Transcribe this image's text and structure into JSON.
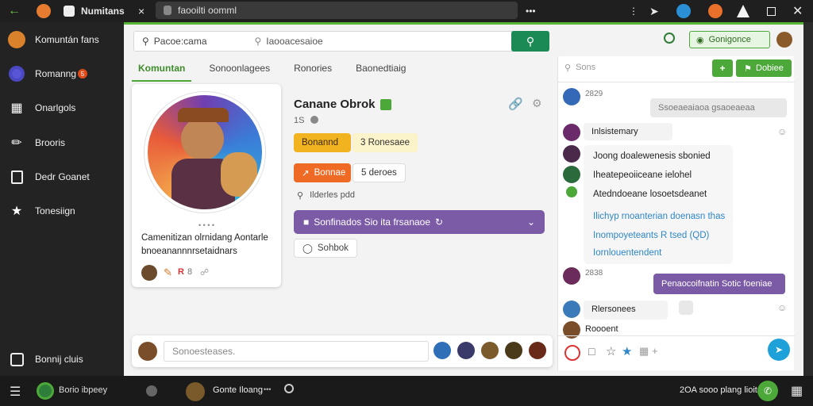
{
  "browser": {
    "tab_title": "Numitans",
    "tab_close": "×",
    "address": "faooilti oomml",
    "more": "•••"
  },
  "sidebar": {
    "items": [
      {
        "label": "Komuntán fans",
        "icon": "user-avatar-icon"
      },
      {
        "label": "Romanng",
        "badge": "5",
        "icon": "gamepad-icon"
      },
      {
        "label": "Onarlgols",
        "icon": "book-icon"
      },
      {
        "label": "Brooris",
        "icon": "chat-icon"
      },
      {
        "label": "Dedr Goanet",
        "icon": "tablet-icon"
      },
      {
        "label": "Tonesiign",
        "icon": "star-icon"
      }
    ],
    "bottom_item": {
      "label": "Bonnij cluis",
      "icon": "discord-icon"
    }
  },
  "header": {
    "search_left": "Pacoe:cama",
    "search_placeholder": "Iaooacesaioe",
    "right_button": "Gonigonce",
    "colors": {
      "accent": "#4da83a",
      "search_btn": "#1b8a55"
    }
  },
  "tabs": [
    {
      "label": "Komuntan",
      "active": true
    },
    {
      "label": "Sonoonlagees",
      "active": false
    },
    {
      "label": "Ronories",
      "active": false
    },
    {
      "label": "Baonedtiaig",
      "active": false
    }
  ],
  "profile": {
    "caption_line1": "Camenitizan olrnidang Aontarle",
    "caption_line2": "bnoeanannnrsetaidnars",
    "dots": "• • • •",
    "icons_row_text": "R",
    "icons_row_num": "8"
  },
  "player": {
    "name": "Canane Obrok",
    "meta": "1S",
    "badge_orange_label": "Bonannd",
    "badge_orange_side": "3 Ronesaee",
    "badge_red_label": "Bonnae",
    "badge_red_side": "5 deroes",
    "pin_text": "Ilderles pdd",
    "purple_bar": "Sonfinados Sio ita frsanaoe",
    "subbtn": "Sohbok"
  },
  "chat": {
    "search_placeholder": "Sons",
    "buttons": [
      "+",
      "Dobiee"
    ],
    "messages": [
      {
        "time": "2829",
        "text": "Ssoeaeaiaoa gsaoeaeaa",
        "side": "right"
      },
      {
        "text": "Inlsistemary",
        "side": "left"
      },
      {
        "text": "Joong doalewenesis sbonied",
        "side": "left"
      },
      {
        "text": "Iheatepeoiiceane ielohel",
        "side": "left"
      },
      {
        "text": "Atedndoeane losoetsdeanet",
        "side": "left"
      },
      {
        "text": "Ilichyp rnoanterian doenasn thas",
        "side": "left"
      },
      {
        "text": "Inompoyeteants R tsed (QD)",
        "side": "left"
      },
      {
        "text": "Iornlouentendent",
        "side": "left"
      },
      {
        "time": "2838",
        "text": "Penaocoifnatin Sotic foeniae",
        "side": "right"
      },
      {
        "text": "Rlersonees",
        "side": "left"
      },
      {
        "text": "Roooent",
        "side": "left"
      }
    ]
  },
  "composer": {
    "placeholder": "Sonoesteases."
  },
  "bottom": {
    "left_label": "Borio ibpeey",
    "middle_name": "Gonte Iloang",
    "middle_dots": "•••",
    "right_text": "2OA sooo plang lioit"
  }
}
